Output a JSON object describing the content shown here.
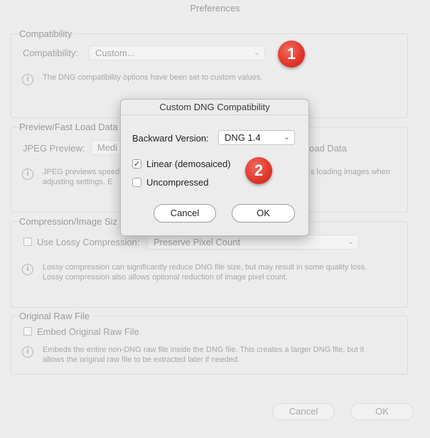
{
  "window": {
    "title": "Preferences"
  },
  "compatibility": {
    "group_title": "Compatibility",
    "label": "Compatibility:",
    "select_value": "Custom...",
    "info_text": "The DNG compatibility options have been set to custom values."
  },
  "preview": {
    "group_title": "Preview/Fast Load Data",
    "jpeg_label": "JPEG Preview:",
    "jpeg_value": "Medi",
    "fast_load_label": "oad Data",
    "info_line1": "JPEG previews speed",
    "info_line1_tail": "s loading images when",
    "info_line2": "adjusting settings.  E"
  },
  "compression": {
    "group_title": "Compression/Image Siz",
    "lossy_label": "Use Lossy Compression:",
    "select_value": "Preserve Pixel Count",
    "info_line1": "Lossy compression can significantly reduce DNG file size, but may result in some quality loss.",
    "info_line2": "Lossy compression also allows optional reduction of image pixel count."
  },
  "raw": {
    "group_title": "Original Raw File",
    "embed_label": "Embed Original Raw File",
    "info_line1": "Embeds the entire non-DNG raw file inside the DNG file.  This creates a larger DNG file, but it",
    "info_line2": "allows the original raw file to be extracted later if needed."
  },
  "footer": {
    "cancel": "Cancel",
    "ok": "OK"
  },
  "modal": {
    "title": "Custom DNG Compatibility",
    "backward_label": "Backward Version:",
    "backward_value": "DNG 1.4",
    "linear_label": "Linear (demosaiced)",
    "linear_checked": true,
    "uncompressed_label": "Uncompressed",
    "uncompressed_checked": false,
    "cancel": "Cancel",
    "ok": "OK"
  },
  "badges": {
    "one": "1",
    "two": "2"
  },
  "icons": {
    "info": "info-icon",
    "checkmark": "checkmark-icon",
    "chevron": "chevron-down-icon"
  },
  "colors": {
    "badge_red": "#e0352a"
  }
}
